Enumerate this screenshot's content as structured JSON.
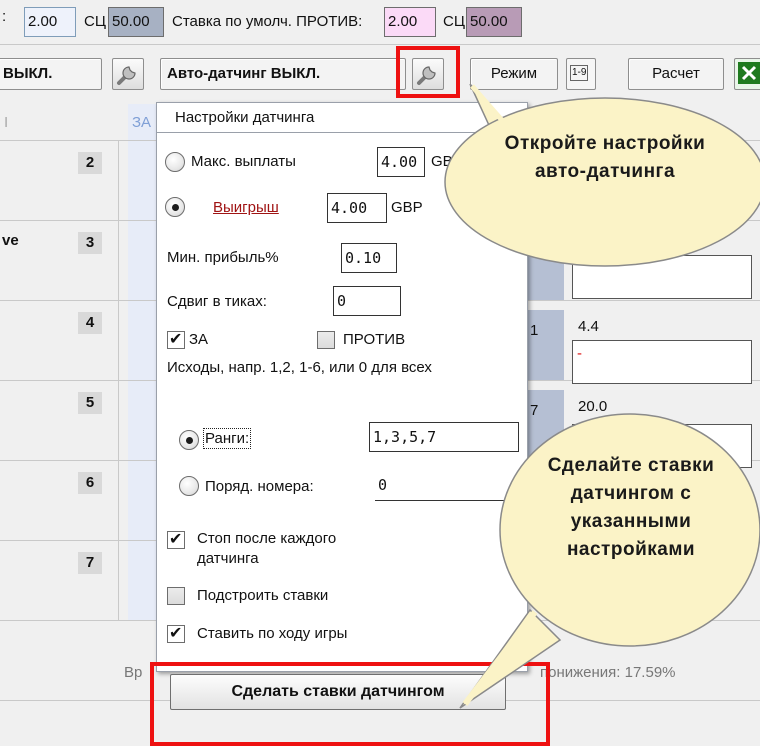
{
  "top_row": {
    "lead": ":",
    "back_value": "2.00",
    "sc1_label": "СЦ",
    "sc1_value": "50.00",
    "default_lay_label": "Ставка по умолч. ПРОТИВ:",
    "lay_value": "2.00",
    "sc2_label": "СЦ",
    "sc2_value": "50.00"
  },
  "toolbar": {
    "off_label": "ВЫКЛ.",
    "autodutch_label": "Авто-датчинг ВЫКЛ.",
    "mode_label": "Режим",
    "range_icon_text": "1-9",
    "calc_label": "Расчет"
  },
  "grid": {
    "partial_header": "I",
    "za_header": "ЗА",
    "row_partial_label": "ve",
    "row_numbers": [
      "2",
      "3",
      "4",
      "5",
      "6",
      "7"
    ],
    "back_partial": [
      "1",
      "7"
    ],
    "lay_values": [
      "4.4",
      "-",
      "20.0"
    ],
    "footer_left": "Вр",
    "footer_right": "понижения: 17.59%"
  },
  "popup": {
    "title": "Настройки датчинга",
    "max_payout_label": "Макс. выплаты",
    "max_payout_value": "4.00",
    "max_payout_currency": "GB",
    "win_label": "Выигрыш",
    "win_value": "4.00",
    "win_currency": "GBP",
    "min_profit_label": "Мин. прибыль%",
    "min_profit_value": "0.10",
    "tick_shift_label": "Сдвиг в тиках:",
    "tick_shift_value": "0",
    "back_label": "ЗА",
    "lay_label": "ПРОТИВ",
    "outcomes_hint": "Исходы, напр. 1,2, 1-6, или 0 для всех",
    "ranks_label": "Ранги:",
    "ranks_value": "1,3,5,7",
    "ordinal_label": "Поряд. номера:",
    "ordinal_value": "0",
    "stop_after_label": "Стоп после каждого датчинга",
    "adjust_bets_label": "Подстроить ставки",
    "inplay_label": "Ставить по ходу игры",
    "make_button": "Сделать ставки датчингом",
    "state": {
      "selected_mode": "win",
      "selected_filter": "ranks",
      "back_checked": true,
      "lay_checked": false,
      "stop_after_checked": true,
      "adjust_bets_checked": false,
      "inplay_checked": true
    }
  },
  "callouts": {
    "open_settings": "Откройте настройки авто-датчинга",
    "make_bets": "Сделайте ставки датчингом с указанными настройками"
  },
  "colors": {
    "annotation_red": "#ee1111",
    "bubble_fill": "#fbf3c7",
    "link_red": "#a01414",
    "back_blue": "#b5bfd3"
  }
}
